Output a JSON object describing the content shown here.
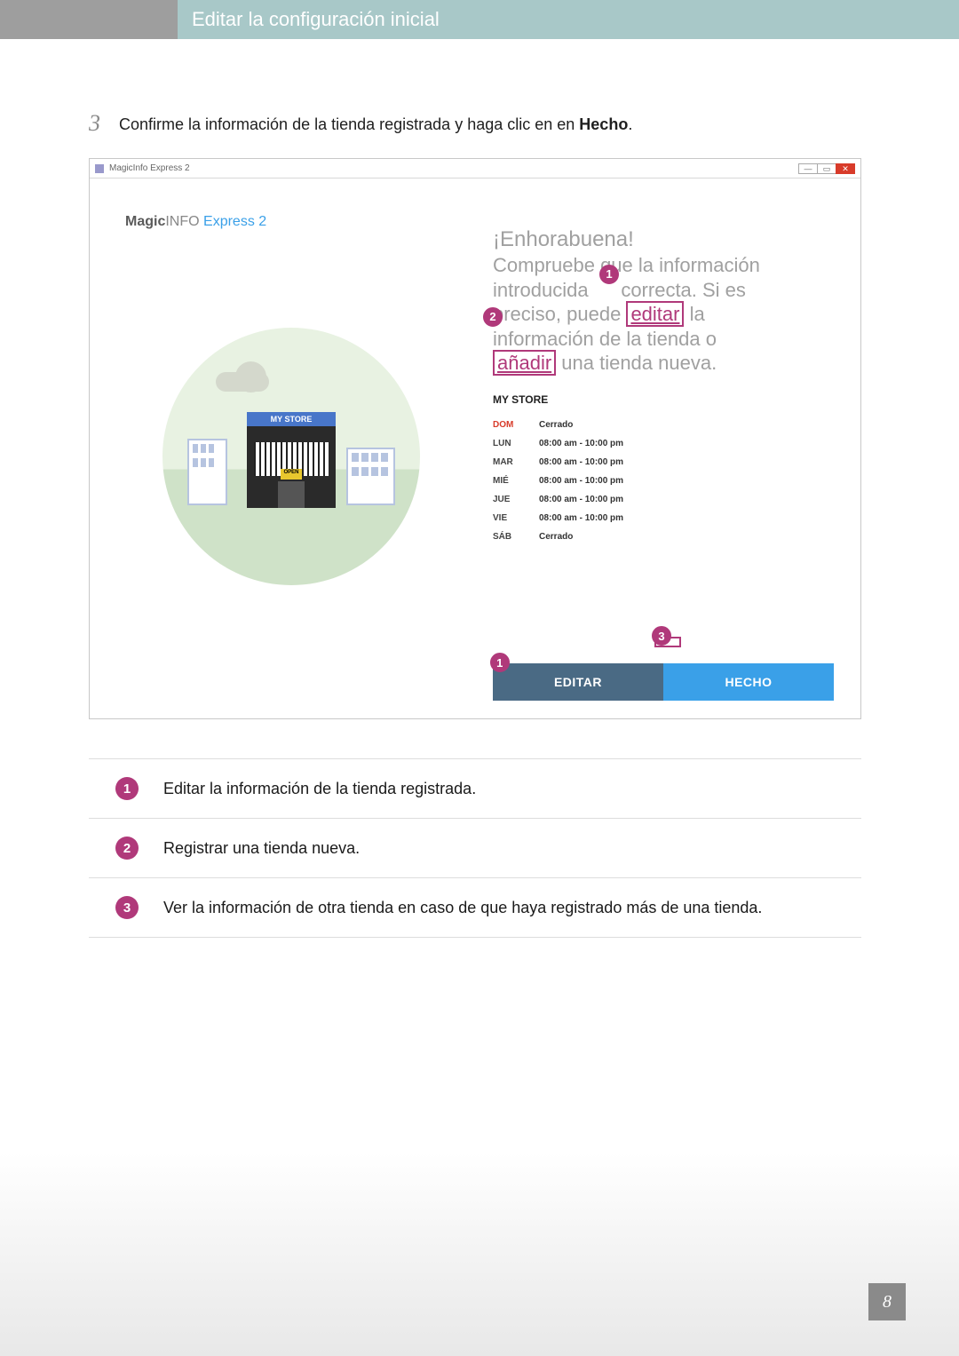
{
  "header": {
    "title": "Editar la configuración inicial"
  },
  "step": {
    "number": "3",
    "text_a": "Confirme la información de la tienda registrada y haga clic en en ",
    "text_bold": "Hecho",
    "text_b": "."
  },
  "screenshot": {
    "titlebar": "MagicInfo Express 2",
    "logo": {
      "magic": "Magic",
      "info": "INFO",
      "express": "Express",
      "ver": "2"
    },
    "illus_sign": "MY STORE",
    "illus_open": "OPEN",
    "congrats_title": "¡Enhorabuena!",
    "congrats_l1": "Compruebe que la información",
    "congrats_l2a": "introducida ",
    "congrats_l2b": " correcta. Si es",
    "congrats_l3a": "preciso, puede ",
    "congrats_l3b": " la",
    "congrats_l4": "información de la tienda o",
    "congrats_l5b": " una tienda nueva.",
    "link_editar": "editar",
    "link_anadir": "añadir",
    "store_title": "MY STORE",
    "hours": {
      "DOM": "Cerrado",
      "LUN": "08:00 am - 10:00 pm",
      "MAR": "08:00 am - 10:00 pm",
      "MIÉ": "08:00 am - 10:00 pm",
      "JUE": "08:00 am - 10:00 pm",
      "VIE": "08:00 am - 10:00 pm",
      "SÁB": "Cerrado"
    },
    "btn_editar": "EDITAR",
    "btn_hecho": "HECHO",
    "callouts": {
      "one": "1",
      "two": "2",
      "three": "3"
    }
  },
  "legend": {
    "n1": "1",
    "t1": "Editar la información de la tienda registrada.",
    "n2": "2",
    "t2": "Registrar una tienda nueva.",
    "n3": "3",
    "t3": "Ver la información de otra tienda en caso de que haya registrado más de una tienda."
  },
  "page_number": "8"
}
